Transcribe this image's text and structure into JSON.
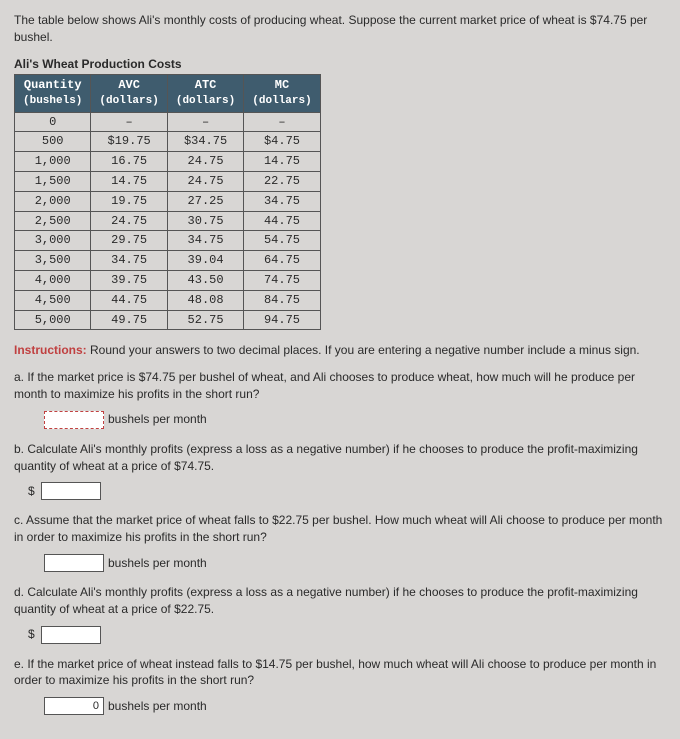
{
  "intro": "The table below shows Ali's monthly costs of producing wheat. Suppose the current market price of wheat is $74.75 per bushel.",
  "table": {
    "title": "Ali's Wheat Production Costs",
    "headers": {
      "qty": "Quantity",
      "qty_unit": "(bushels)",
      "avc": "AVC",
      "avc_unit": "(dollars)",
      "atc": "ATC",
      "atc_unit": "(dollars)",
      "mc": "MC",
      "mc_unit": "(dollars)"
    },
    "rows": [
      {
        "qty": "0",
        "avc": "–",
        "atc": "–",
        "mc": "–"
      },
      {
        "qty": "500",
        "avc": "$19.75",
        "atc": "$34.75",
        "mc": "$4.75"
      },
      {
        "qty": "1,000",
        "avc": "16.75",
        "atc": "24.75",
        "mc": "14.75"
      },
      {
        "qty": "1,500",
        "avc": "14.75",
        "atc": "24.75",
        "mc": "22.75"
      },
      {
        "qty": "2,000",
        "avc": "19.75",
        "atc": "27.25",
        "mc": "34.75"
      },
      {
        "qty": "2,500",
        "avc": "24.75",
        "atc": "30.75",
        "mc": "44.75"
      },
      {
        "qty": "3,000",
        "avc": "29.75",
        "atc": "34.75",
        "mc": "54.75"
      },
      {
        "qty": "3,500",
        "avc": "34.75",
        "atc": "39.04",
        "mc": "64.75"
      },
      {
        "qty": "4,000",
        "avc": "39.75",
        "atc": "43.50",
        "mc": "74.75"
      },
      {
        "qty": "4,500",
        "avc": "44.75",
        "atc": "48.08",
        "mc": "84.75"
      },
      {
        "qty": "5,000",
        "avc": "49.75",
        "atc": "52.75",
        "mc": "94.75"
      }
    ]
  },
  "instructions": {
    "label": "Instructions:",
    "text": " Round your answers to two decimal places. If you are entering a negative number include a minus sign."
  },
  "questions": {
    "a": "a. If the market price is $74.75 per bushel of wheat, and Ali chooses to produce wheat, how much will he produce per month to maximize his profits in the short run?",
    "a_unit": "bushels per month",
    "b": "b. Calculate Ali's monthly profits (express a loss as a negative number) if he chooses to produce the profit-maximizing quantity of wheat at a price of $74.75.",
    "b_prefix": "$",
    "c": "c. Assume that the market price of wheat falls to $22.75 per bushel. How much wheat will Ali choose to produce per month in order to maximize his profits in the short run?",
    "c_unit": "bushels per month",
    "d": "d. Calculate Ali's monthly profits (express a loss as a negative number) if he chooses to produce the profit-maximizing quantity of wheat at a price of $22.75.",
    "d_prefix": "$",
    "e": "e. If the market price of wheat instead falls to $14.75 per bushel, how much wheat will Ali choose to produce per month in order to maximize his profits in the short run?",
    "e_value": "0",
    "e_unit": "bushels per month"
  }
}
